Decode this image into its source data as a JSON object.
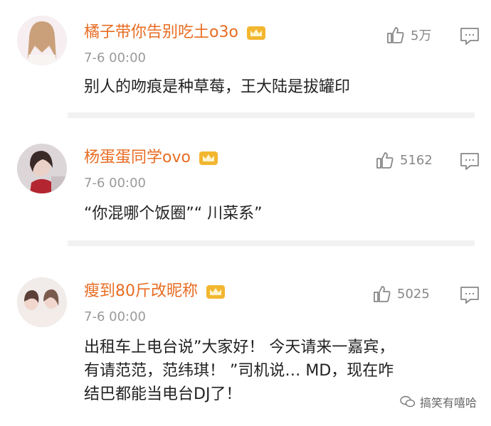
{
  "comments": [
    {
      "username": "橘子带你告别吃土o3o",
      "time": "7-6 00:00",
      "likes": "5万",
      "text": "别人的吻痕是种草莓，王大陆是拔罐印"
    },
    {
      "username": "杨蛋蛋同学ovo",
      "time": "7-6 00:00",
      "likes": "5162",
      "text": "“你混哪个饭圈”“ 川菜系”"
    },
    {
      "username": "瘦到80斤改昵称",
      "time": "7-6 00:00",
      "likes": "5025",
      "text_lines": [
        "出租车上电台说”大家好！ 今天请来一嘉宾，",
        "有请范范，范纬琪！ ”司机说… MD，现在咋",
        "结巴都能当电台DJ了！"
      ]
    }
  ],
  "watermark": {
    "text": "搞笑有嘻哈"
  },
  "colors": {
    "username": "#e86c22",
    "time": "#9a9a9a",
    "divider": "#f2f2f2"
  },
  "icons": {
    "like": "thumbs-up-icon",
    "reply": "comment-bubble-icon",
    "vip": "crown-icon",
    "watermark": "wechat-icon"
  }
}
